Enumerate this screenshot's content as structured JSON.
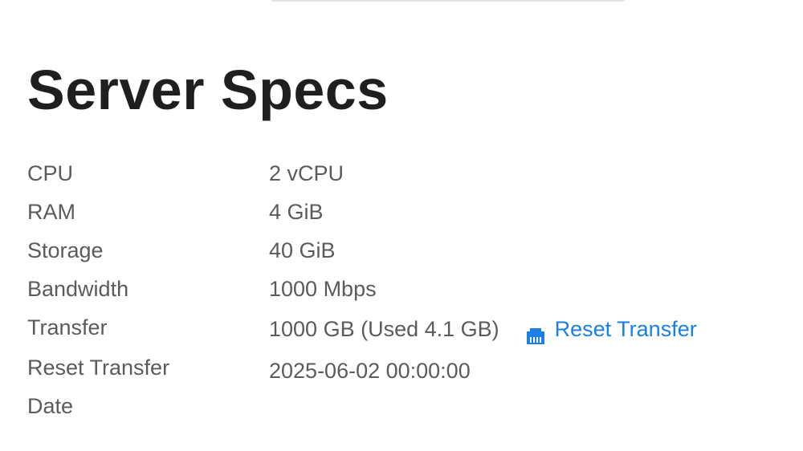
{
  "page": {
    "title": "Server Specs"
  },
  "specs": {
    "cpu": {
      "label": "CPU",
      "value": "2 vCPU"
    },
    "ram": {
      "label": "RAM",
      "value": "4 GiB"
    },
    "storage": {
      "label": "Storage",
      "value": "40 GiB"
    },
    "bandwidth": {
      "label": "Bandwidth",
      "value": "1000 Mbps"
    },
    "transfer": {
      "label": "Transfer",
      "value": "1000 GB (Used 4.1 GB)",
      "action_label": "Reset Transfer",
      "action_icon": "ethernet-port-icon"
    },
    "reset_date": {
      "label_line1": "Reset Transfer",
      "label_line2": "Date",
      "value": "2025-06-02 00:00:00"
    }
  },
  "colors": {
    "link": "#1a7fe8",
    "label": "#5b5b5b",
    "title": "#1f1f1f"
  }
}
